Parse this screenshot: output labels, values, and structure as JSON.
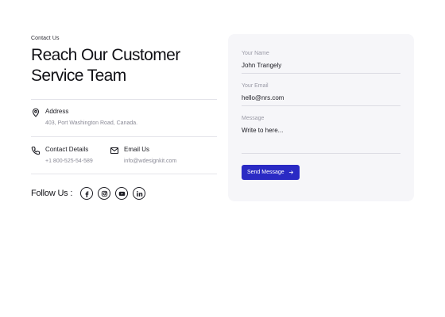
{
  "contact": {
    "eyebrow": "Contact Us",
    "heading_line1": "Reach Our Customer",
    "heading_line2": "Service Team",
    "address": {
      "title": "Address",
      "value": "403, Port Washington Road, Canada.",
      "icon": "location-pin-icon"
    },
    "phone": {
      "title": "Contact Details",
      "value": "+1 800-525-54-589",
      "icon": "phone-icon"
    },
    "email": {
      "title": "Email Us",
      "value": "info@wdesignkit.com",
      "icon": "mail-icon"
    },
    "follow": {
      "label": "Follow Us :",
      "icons": [
        "facebook-icon",
        "instagram-icon",
        "youtube-icon",
        "linkedin-icon"
      ]
    }
  },
  "form": {
    "name": {
      "label": "Your Name",
      "value": "John Trangely"
    },
    "email": {
      "label": "Your Email",
      "value": "hello@nrs.com"
    },
    "message": {
      "label": "Message",
      "placeholder": "Write to here..."
    },
    "submit_label": "Send Message"
  },
  "colors": {
    "accent": "#2a2ac4",
    "card_bg": "#f6f6f9"
  }
}
